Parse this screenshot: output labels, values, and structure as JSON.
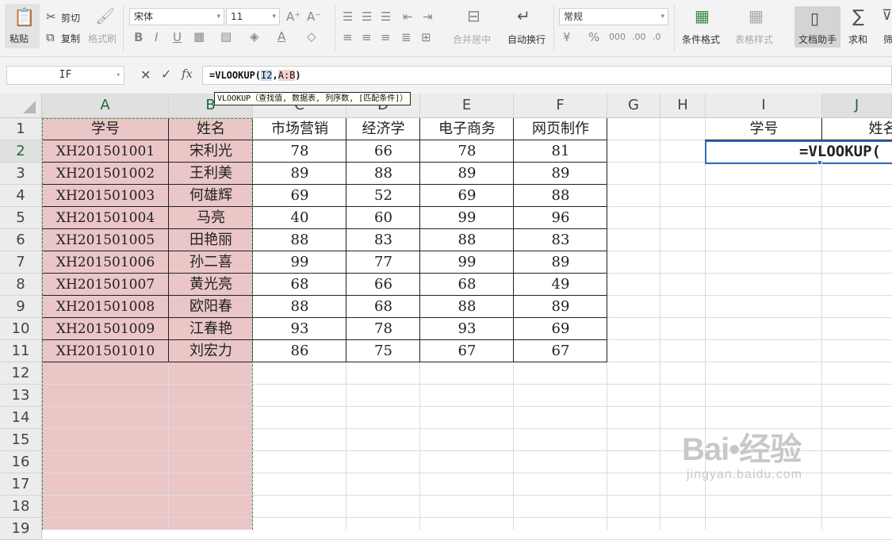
{
  "ribbon": {
    "paste_label": "粘贴",
    "cut_label": "剪切",
    "copy_label": "复制",
    "format_painter_label": "格式刷",
    "font_name": "宋体",
    "font_size": "11",
    "merge_center_label": "合并居中",
    "wrap_text_label": "自动换行",
    "number_format": "常规",
    "conditional_format_label": "条件格式",
    "table_style_label": "表格样式",
    "doc_assistant_label": "文档助手",
    "sum_label": "求和",
    "filter_label": "筛"
  },
  "formula_bar": {
    "name_box": "IF",
    "fx_label": "fx",
    "formula_prefix": "=VLOOKUP(",
    "ref1": "I2",
    "comma": ",",
    "ref2": "A:B",
    "formula_suffix": ")",
    "tooltip": "VLOOKUP（查找值, 数据表, 列序数, [匹配条件]）"
  },
  "columns": [
    "A",
    "B",
    "C",
    "D",
    "E",
    "F",
    "G",
    "H",
    "I",
    "J"
  ],
  "rows": [
    "1",
    "2",
    "3",
    "4",
    "5",
    "6",
    "7",
    "8",
    "9",
    "10",
    "11",
    "12",
    "13",
    "14",
    "15",
    "16",
    "17",
    "18",
    "19"
  ],
  "table": {
    "headers": [
      "学号",
      "姓名",
      "市场营销",
      "经济学",
      "电子商务",
      "网页制作"
    ],
    "rows": [
      [
        "XH201501001",
        "宋利光",
        "78",
        "66",
        "78",
        "81"
      ],
      [
        "XH201501002",
        "王利美",
        "89",
        "88",
        "89",
        "89"
      ],
      [
        "XH201501003",
        "何雄辉",
        "69",
        "52",
        "69",
        "88"
      ],
      [
        "XH201501004",
        "马亮",
        "40",
        "60",
        "99",
        "96"
      ],
      [
        "XH201501005",
        "田艳丽",
        "88",
        "83",
        "88",
        "83"
      ],
      [
        "XH201501006",
        "孙二喜",
        "99",
        "77",
        "99",
        "89"
      ],
      [
        "XH201501007",
        "黄光亮",
        "68",
        "66",
        "68",
        "49"
      ],
      [
        "XH201501008",
        "欧阳春",
        "88",
        "68",
        "88",
        "89"
      ],
      [
        "XH201501009",
        "江春艳",
        "93",
        "78",
        "93",
        "69"
      ],
      [
        "XH201501010",
        "刘宏力",
        "86",
        "75",
        "67",
        "67"
      ]
    ]
  },
  "lookup": {
    "header_i": "学号",
    "header_j": "姓名",
    "active_cell_text": "=VLOOKUP("
  },
  "watermark": {
    "logo": "Bai•经验",
    "url": "jingyan.baidu.com"
  },
  "colors": {
    "selection_pink": "#eac6c6",
    "active_blue": "#2f6fbf",
    "marquee_green": "#3e8e4e"
  }
}
